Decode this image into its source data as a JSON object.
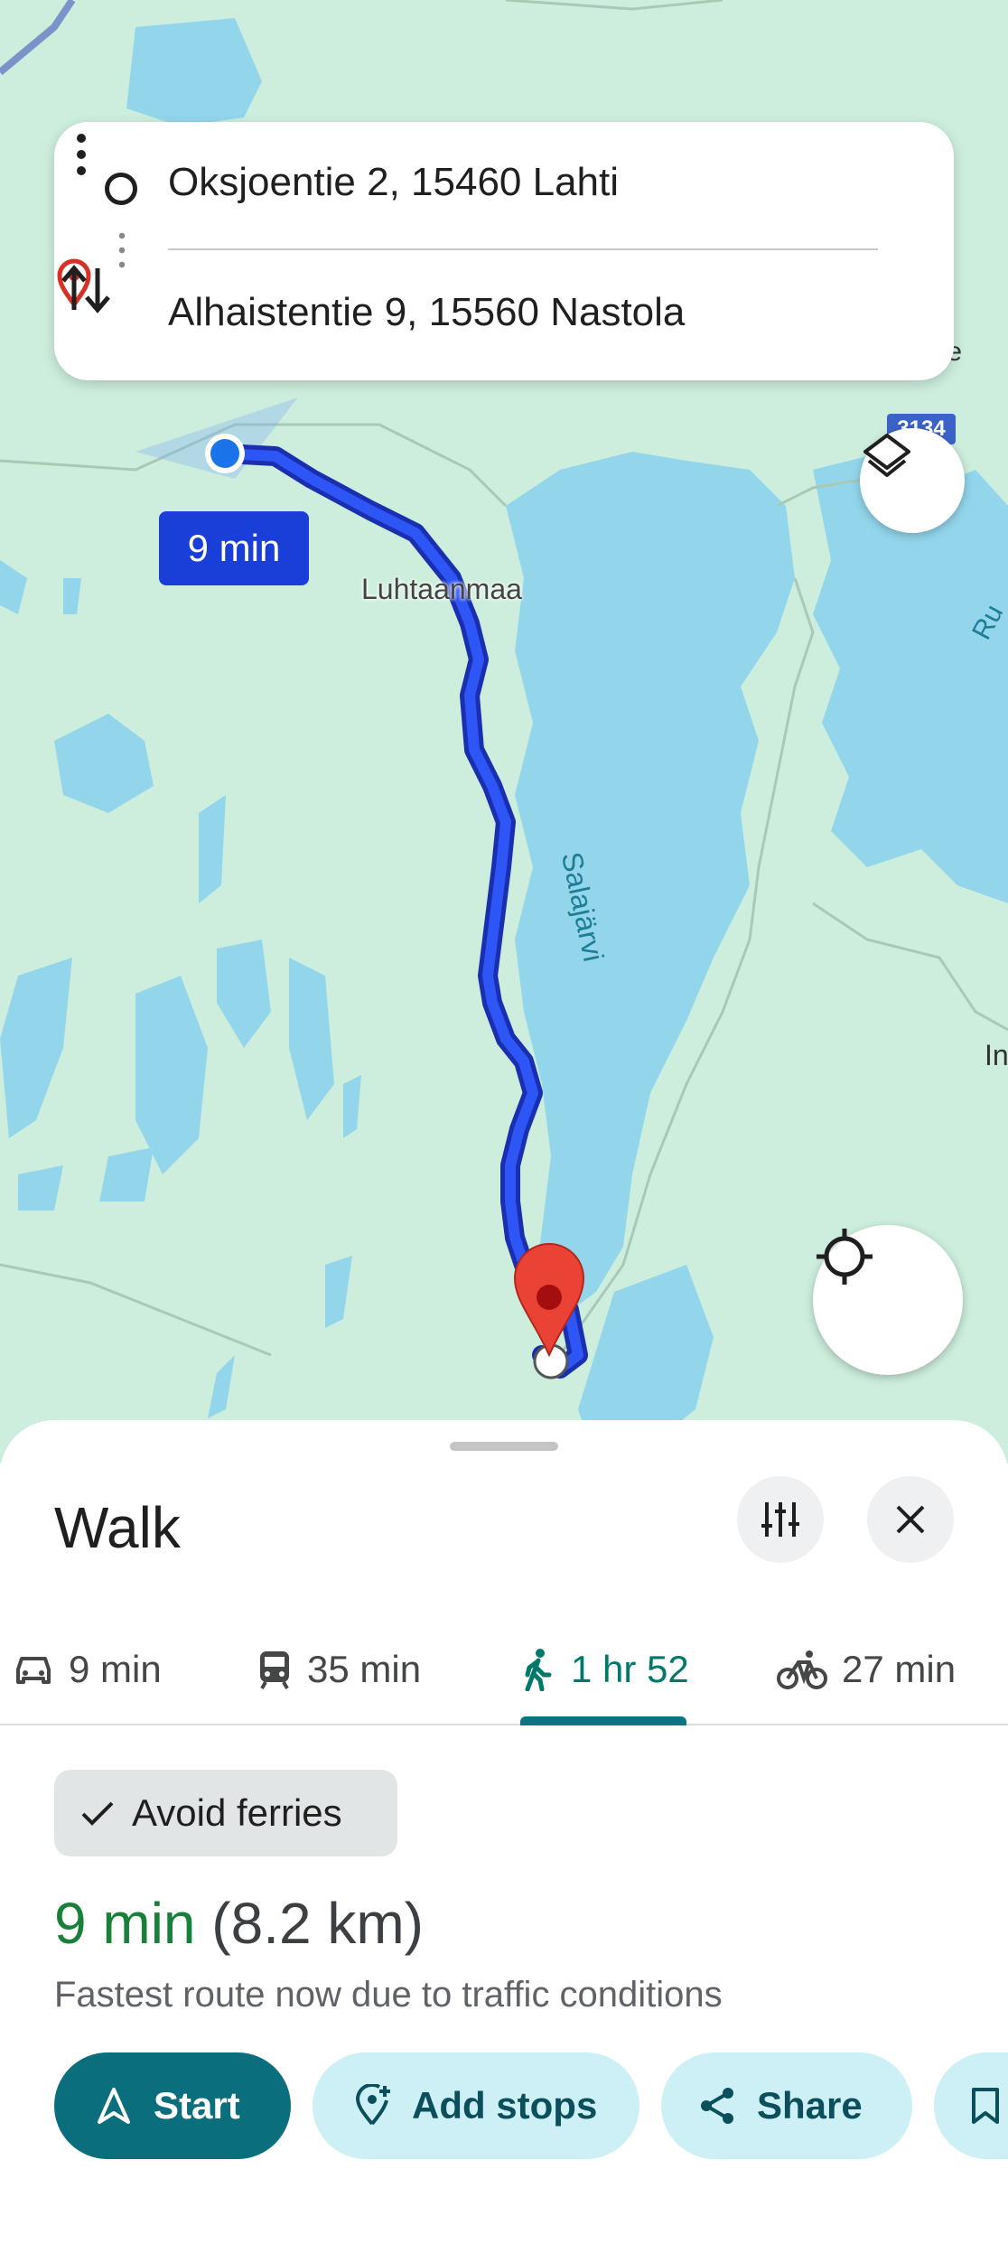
{
  "route": {
    "origin": "Oksjoentie 2, 15460 Lahti",
    "destination": "Alhaistentie 9, 15560 Nastola"
  },
  "map": {
    "time_bubble": "9 min",
    "labels": {
      "luhtaanmaa": "Luhtaanmaa",
      "salajarvi": "Salajärvi",
      "rw": "Ru",
      "in": "In",
      "te": "te"
    },
    "road_shield": "3134",
    "colors": {
      "land": "#cdeedd",
      "water": "#93d6ec",
      "route": "#1a3fd8",
      "destination_pin": "#ea4335"
    }
  },
  "sheet": {
    "title": "Walk",
    "modes": [
      {
        "icon": "car-icon",
        "label": "9 min"
      },
      {
        "icon": "train-icon",
        "label": "35 min"
      },
      {
        "icon": "walk-icon",
        "label": "1 hr 52",
        "selected": true
      },
      {
        "icon": "bike-icon",
        "label": "27 min"
      }
    ],
    "chip": "Avoid ferries",
    "summary_time": "9 min",
    "summary_distance": "(8.2 km)",
    "summary_note": "Fastest route now due to traffic conditions",
    "actions": {
      "start": "Start",
      "add_stops": "Add stops",
      "share": "Share"
    }
  }
}
